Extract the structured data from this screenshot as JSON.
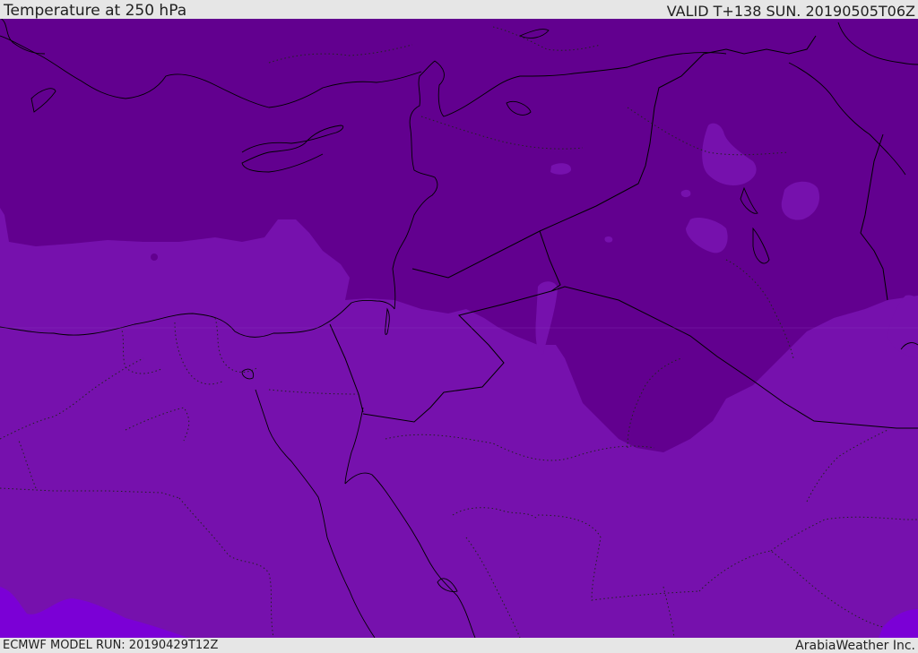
{
  "header": {
    "title": "Temperature at 250 hPa",
    "valid_time": "VALID T+138 SUN. 20190505T06Z"
  },
  "footer": {
    "model_run": "ECMWF MODEL RUN: 20190429T12Z",
    "credit": "ArabiaWeather Inc."
  },
  "map": {
    "field": "temperature",
    "level": "250 hPa",
    "colors": {
      "cold": "#62008f",
      "medium": "#7611ad",
      "warm": "#7b00d6",
      "coast": "#000000",
      "border": "#000000",
      "internal_border": "#333333"
    }
  }
}
